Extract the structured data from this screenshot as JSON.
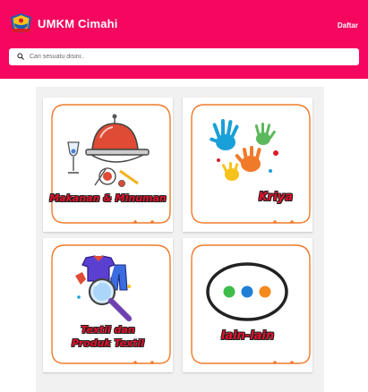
{
  "header": {
    "title": "UMKM  Cimahi",
    "register_label": "Daftar",
    "logo_icon": "cimahi-crest-logo",
    "bg_color": "#f5075f"
  },
  "search": {
    "placeholder": "Cari sesuatu disini..",
    "value": ""
  },
  "categories": [
    {
      "label": "Makanan & Minuman",
      "icon": "food-cloche-icon"
    },
    {
      "label": "Kriya",
      "icon": "paint-hands-icon"
    },
    {
      "label_line1": "Textil dan",
      "label_line2": "Produk Textil",
      "icon": "textile-magnifier-icon"
    },
    {
      "label": "lain-lain",
      "icon": "more-dots-icon"
    }
  ],
  "colors": {
    "accent_orange": "#f07a2a",
    "label_red": "#e4102b"
  }
}
